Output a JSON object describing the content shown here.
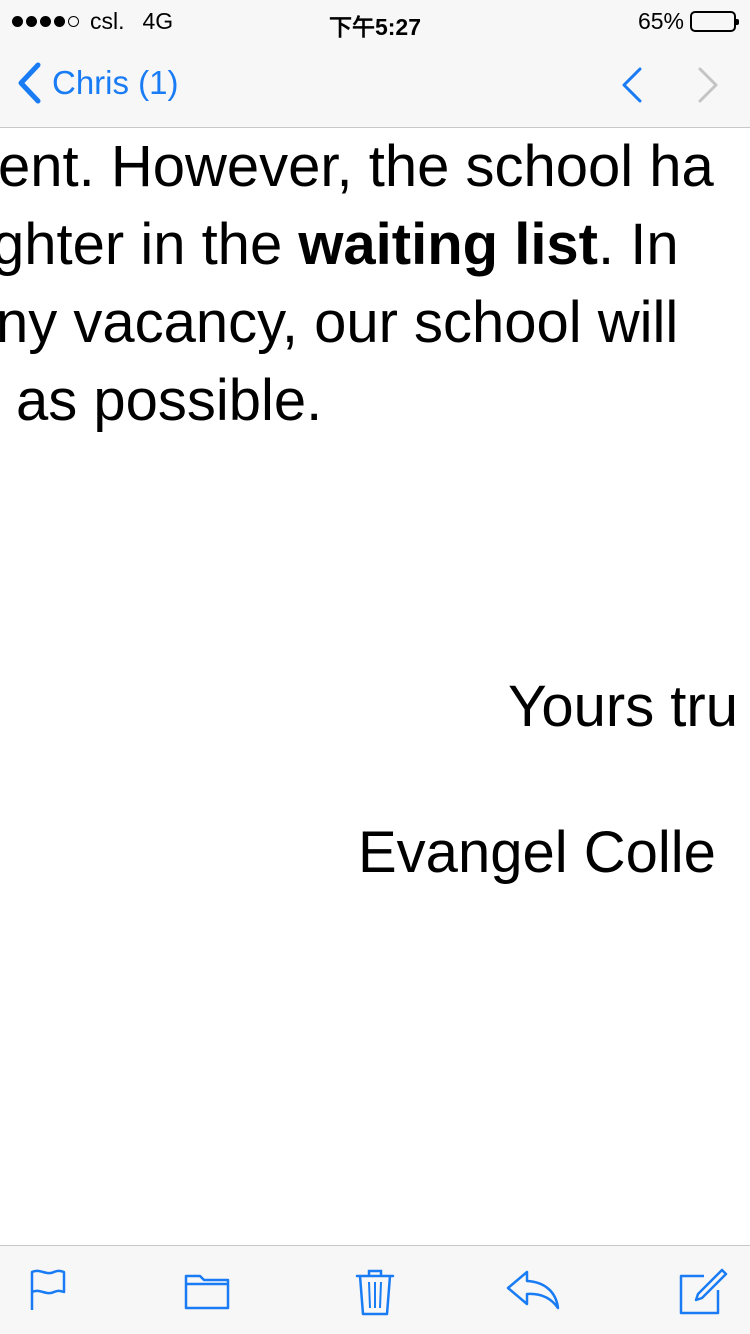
{
  "status_bar": {
    "carrier": "csl.",
    "network": "4G",
    "time": "下午5:27",
    "battery_percent": "65%",
    "battery_level": 0.65,
    "signal_bars_filled": 4,
    "signal_bars_total": 5
  },
  "nav": {
    "back_label": "Chris (1)",
    "accent_color": "#1a7cf5"
  },
  "email": {
    "line1": "ent. However, the school ha",
    "line2_prefix": "ghter in the ",
    "line2_bold": "waiting list",
    "line2_suffix": ". In",
    "line3": "ny vacancy, our school will",
    "line4": " as possible.",
    "closing": "Yours tru",
    "signature": "Evangel Colle"
  },
  "toolbar": {
    "icons": [
      "flag-icon",
      "folder-icon",
      "trash-icon",
      "reply-icon",
      "compose-icon"
    ]
  }
}
